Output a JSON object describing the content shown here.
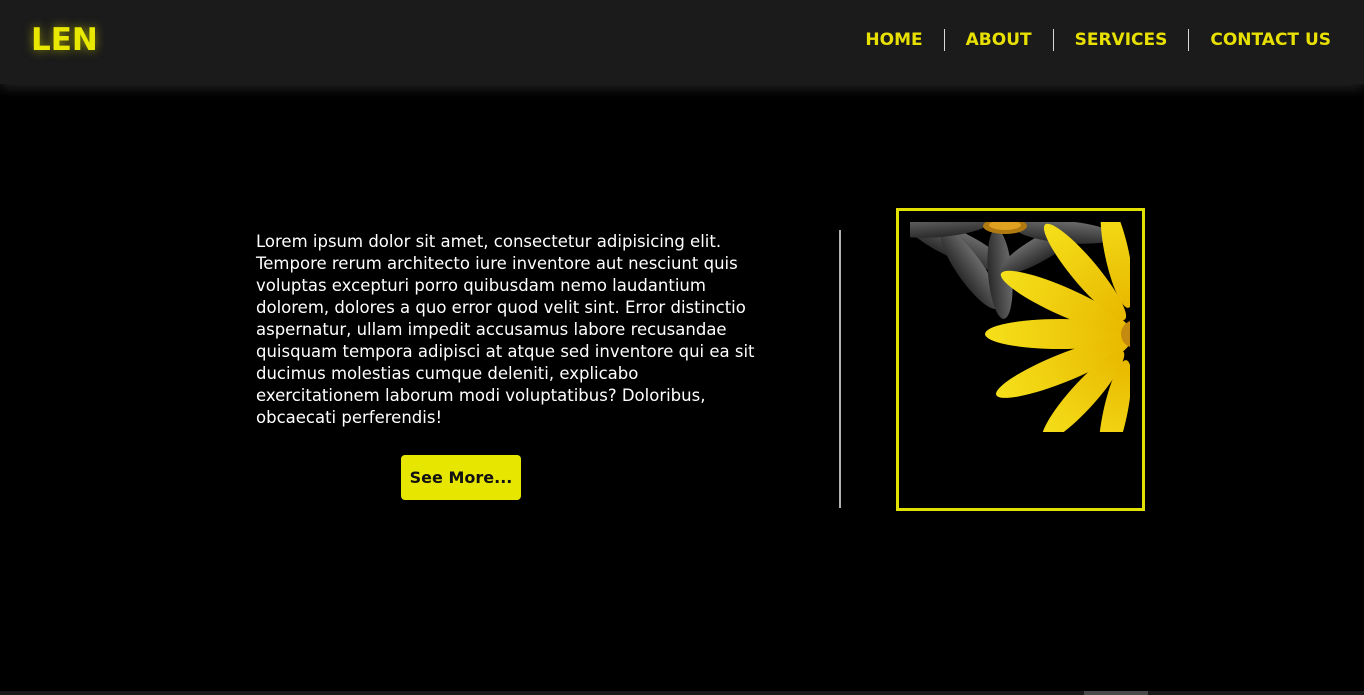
{
  "header": {
    "logo": "LEN",
    "nav": [
      {
        "label": "HOME"
      },
      {
        "label": "ABOUT"
      },
      {
        "label": "SERVICES"
      },
      {
        "label": "CONTACT US"
      }
    ]
  },
  "main": {
    "paragraph": "Lorem ipsum dolor sit amet, consectetur adipisicing elit. Tempore rerum architecto iure inventore aut nesciunt quis voluptas excepturi porro quibusdam nemo laudantium dolorem, dolores a quo error quod velit sint. Error distinctio aspernatur, ullam impedit accusamus labore recusandae quisquam tempora adipisci at atque sed inventore qui ea sit ducimus molestias cumque deleniti, explicabo exercitationem laborum modi voluptatibus? Doloribus, obcaecati perferendis!",
    "button_label": "See More..."
  },
  "colors": {
    "accent": "#e6e600",
    "background": "#000000",
    "header_bg": "#1b1b1b",
    "text": "#ffffff"
  },
  "icons": {
    "photo": "yellow-flower-photo"
  }
}
